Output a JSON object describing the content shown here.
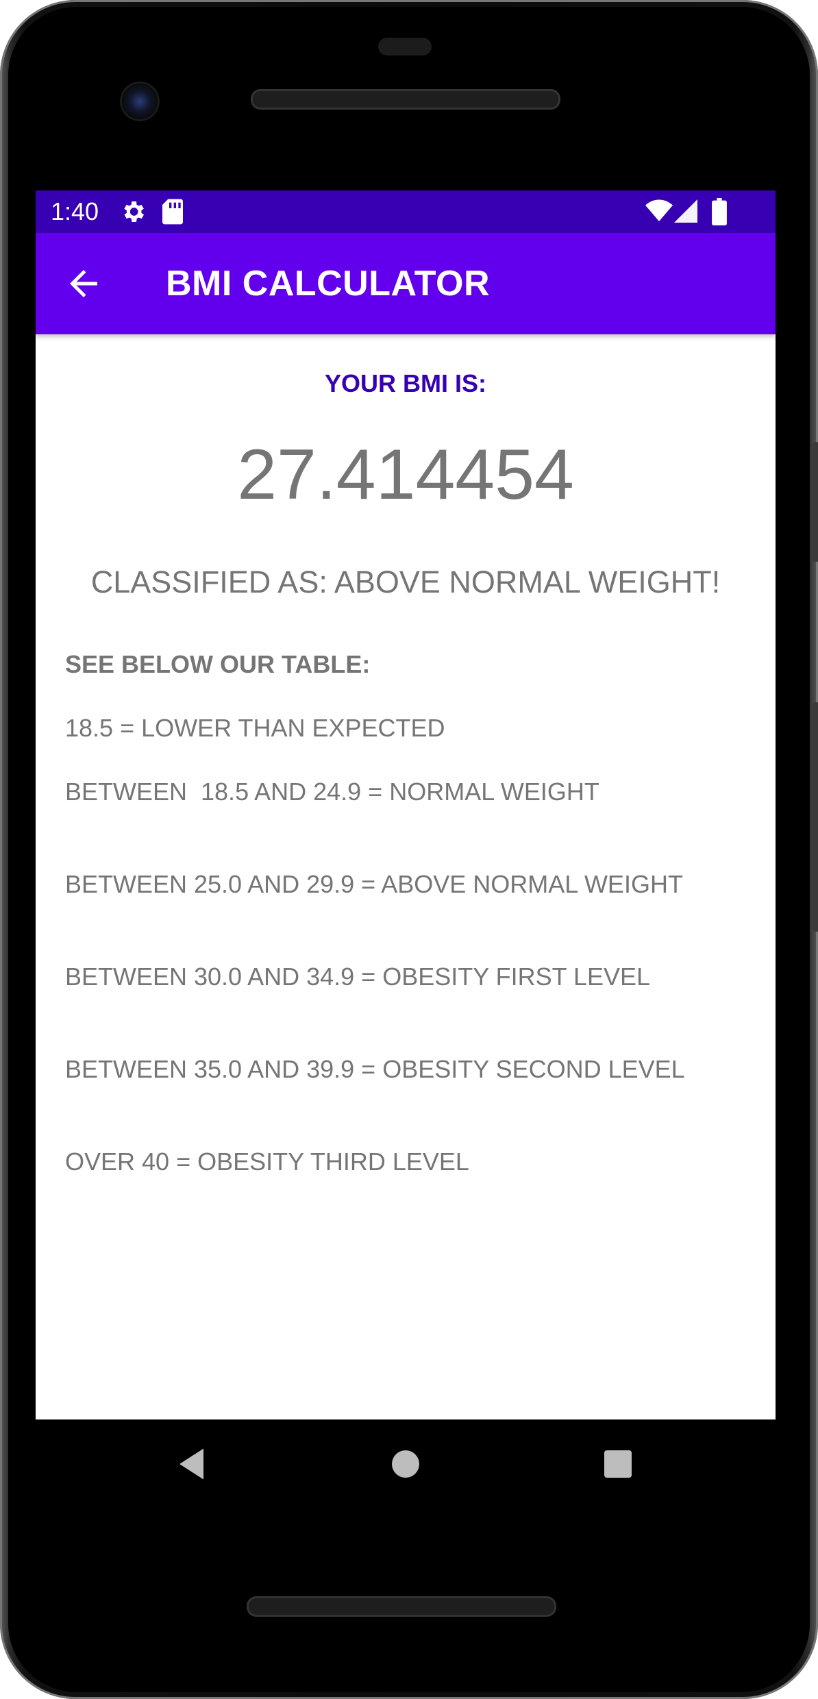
{
  "status_bar": {
    "time": "1:40",
    "icons": [
      "gear-icon",
      "sd-card-icon",
      "wifi-icon",
      "signal-icon",
      "battery-icon"
    ]
  },
  "app_bar": {
    "title": "BMI CALCULATOR",
    "nav_icon": "arrow-back-icon"
  },
  "result": {
    "label": "YOUR BMI IS:",
    "value": "27.414454",
    "classification": "CLASSIFIED AS: ABOVE NORMAL WEIGHT!"
  },
  "table": {
    "heading": "SEE BELOW OUR TABLE:",
    "lines": [
      "18.5 = LOWER THAN EXPECTED",
      "BETWEEN  18.5 AND 24.9 = NORMAL WEIGHT",
      "BETWEEN 25.0 AND 29.9 = ABOVE NORMAL WEIGHT",
      "BETWEEN 30.0 AND 34.9 = OBESITY FIRST LEVEL",
      "BETWEEN 35.0 AND 39.9 = OBESITY SECOND LEVEL",
      "OVER 40 = OBESITY THIRD LEVEL"
    ]
  },
  "navigation_bar": {
    "buttons": [
      "nav-back-icon",
      "nav-home-icon",
      "nav-recents-icon"
    ]
  },
  "colors": {
    "status_bar": "#3700b3",
    "app_bar": "#6200ee",
    "accent_text": "#3700b3",
    "body_text": "#757575"
  }
}
